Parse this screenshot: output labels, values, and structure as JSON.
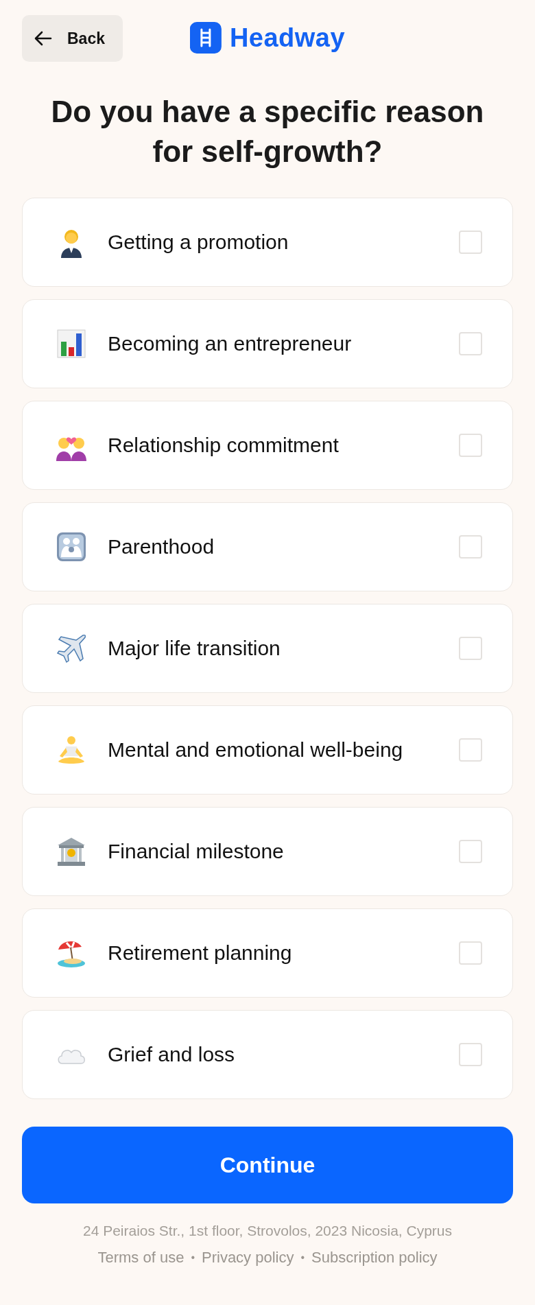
{
  "header": {
    "back_button": {
      "label": "Back"
    },
    "logo": {
      "text": "Headway"
    }
  },
  "title": "Do you have a specific reason for self-growth?",
  "options": [
    {
      "label": "Getting a promotion",
      "checked": false
    },
    {
      "label": "Becoming an entrepreneur",
      "checked": false
    },
    {
      "label": "Relationship commitment",
      "checked": false
    },
    {
      "label": "Parenthood",
      "checked": false
    },
    {
      "label": "Major life transition",
      "checked": false
    },
    {
      "label": "Mental and emotional well-being",
      "checked": false
    },
    {
      "label": "Financial milestone",
      "checked": false
    },
    {
      "label": "Retirement planning",
      "checked": false
    },
    {
      "label": "Grief and loss",
      "checked": false
    }
  ],
  "continue_button": {
    "label": "Continue"
  },
  "footer": {
    "address": "24 Peiraios Str., 1st floor, Strovolos, 2023 Nicosia, Cyprus",
    "links": [
      {
        "kind": "link",
        "text": "Terms of use"
      },
      {
        "kind": "separator",
        "text": "•"
      },
      {
        "kind": "link",
        "text": "Privacy policy"
      },
      {
        "kind": "separator",
        "text": "•"
      },
      {
        "kind": "link",
        "text": "Subscription policy"
      }
    ]
  }
}
